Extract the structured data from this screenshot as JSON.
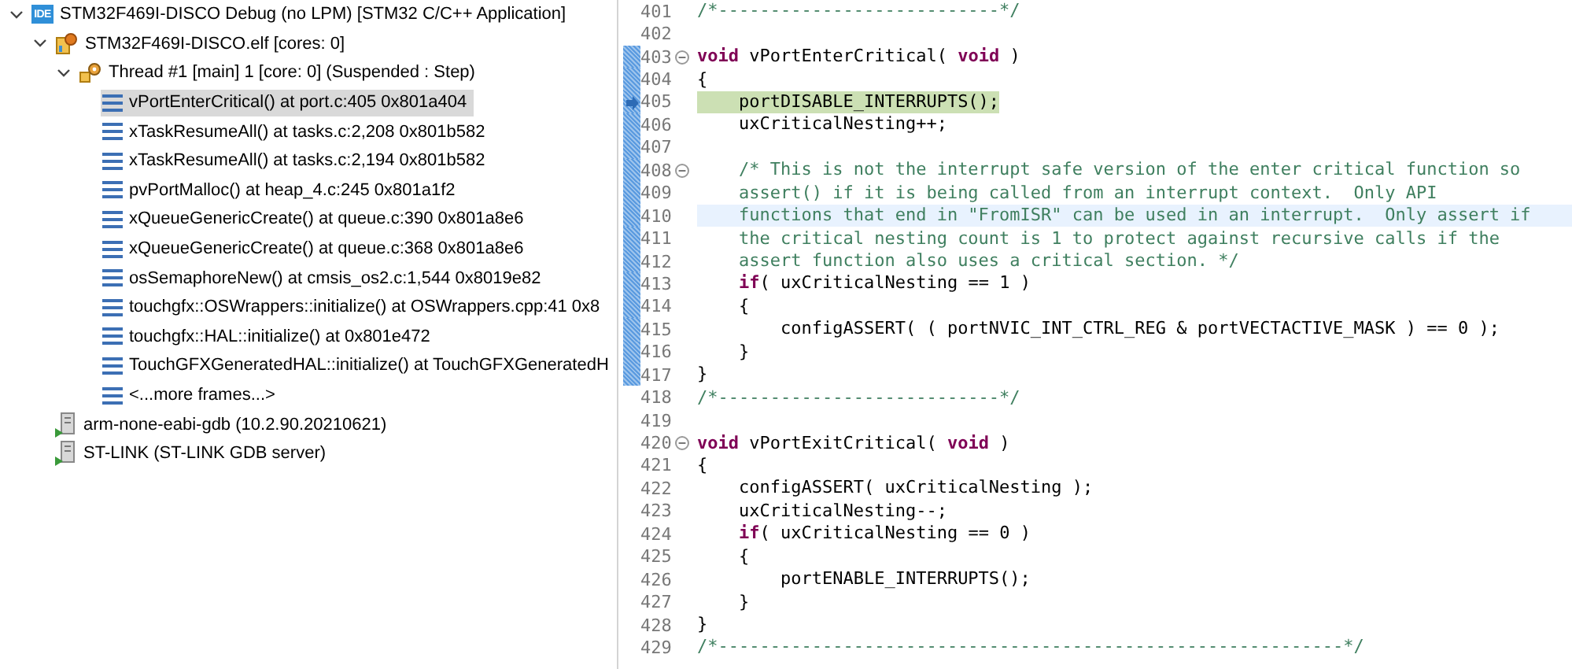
{
  "debug_tree": [
    {
      "kind": "launch",
      "badge": "IDE",
      "label": "STM32F469I-DISCO Debug (no LPM) [STM32 C/C++ Application]",
      "expanded": true,
      "children": [
        {
          "kind": "target",
          "label": "STM32F469I-DISCO.elf [cores: 0]",
          "expanded": true,
          "children": [
            {
              "kind": "thread",
              "label": "Thread #1 [main] 1 [core: 0] (Suspended : Step)",
              "expanded": true,
              "children": [
                {
                  "kind": "frame",
                  "label": "vPortEnterCritical() at port.c:405 0x801a404",
                  "selected": true
                },
                {
                  "kind": "frame",
                  "label": "xTaskResumeAll() at tasks.c:2,208 0x801b582",
                  "selected": false
                },
                {
                  "kind": "frame",
                  "label": "xTaskResumeAll() at tasks.c:2,194 0x801b582",
                  "selected": false
                },
                {
                  "kind": "frame",
                  "label": "pvPortMalloc() at heap_4.c:245 0x801a1f2",
                  "selected": false
                },
                {
                  "kind": "frame",
                  "label": "xQueueGenericCreate() at queue.c:390 0x801a8e6",
                  "selected": false
                },
                {
                  "kind": "frame",
                  "label": "xQueueGenericCreate() at queue.c:368 0x801a8e6",
                  "selected": false
                },
                {
                  "kind": "frame",
                  "label": "osSemaphoreNew() at cmsis_os2.c:1,544 0x8019e82",
                  "selected": false
                },
                {
                  "kind": "frame",
                  "label": "touchgfx::OSWrappers::initialize() at OSWrappers.cpp:41 0x8",
                  "selected": false
                },
                {
                  "kind": "frame",
                  "label": "touchgfx::HAL::initialize() at 0x801e472",
                  "selected": false
                },
                {
                  "kind": "frame",
                  "label": "TouchGFXGeneratedHAL::initialize() at TouchGFXGeneratedH",
                  "selected": false
                },
                {
                  "kind": "frame",
                  "label": "<...more frames...>",
                  "selected": false
                }
              ]
            }
          ]
        },
        {
          "kind": "process",
          "label": "arm-none-eabi-gdb (10.2.90.20210621)"
        },
        {
          "kind": "process",
          "label": "ST-LINK (ST-LINK GDB server)"
        }
      ]
    }
  ],
  "editor": {
    "lines": [
      {
        "number": "401",
        "foldable": false,
        "current": false,
        "highlighted": false,
        "in_range": false,
        "segments": [
          {
            "kind": "comment",
            "text": "/*---------------------------*/"
          }
        ]
      },
      {
        "number": "402",
        "foldable": false,
        "current": false,
        "highlighted": false,
        "in_range": false
      },
      {
        "number": "403",
        "foldable": true,
        "current": false,
        "highlighted": false,
        "in_range": true,
        "segments": [
          {
            "kind": "keyword",
            "text": "void"
          },
          {
            "kind": "plain",
            "text": " vPortEnterCritical( "
          },
          {
            "kind": "keyword",
            "text": "void"
          },
          {
            "kind": "plain",
            "text": " )"
          }
        ]
      },
      {
        "number": "404",
        "foldable": false,
        "current": false,
        "highlighted": false,
        "in_range": true,
        "segments": [
          {
            "kind": "plain",
            "text": "{"
          }
        ]
      },
      {
        "number": "405",
        "foldable": false,
        "current": true,
        "highlighted": false,
        "in_range": true,
        "segments": [
          {
            "kind": "plain",
            "text": "    portDISABLE_INTERRUPTS();"
          }
        ]
      },
      {
        "number": "406",
        "foldable": false,
        "current": false,
        "highlighted": false,
        "in_range": true,
        "segments": [
          {
            "kind": "plain",
            "text": "    uxCriticalNesting++;"
          }
        ]
      },
      {
        "number": "407",
        "foldable": false,
        "current": false,
        "highlighted": false,
        "in_range": true
      },
      {
        "number": "408",
        "foldable": true,
        "current": false,
        "highlighted": false,
        "in_range": true,
        "segments": [
          {
            "kind": "comment",
            "text": "    /* This is not the interrupt safe version of the enter critical function so"
          }
        ]
      },
      {
        "number": "409",
        "foldable": false,
        "current": false,
        "highlighted": false,
        "in_range": true,
        "segments": [
          {
            "kind": "comment",
            "text": "    assert() if it is being called from an interrupt context.  Only API"
          }
        ]
      },
      {
        "number": "410",
        "foldable": false,
        "current": false,
        "highlighted": true,
        "in_range": true,
        "segments": [
          {
            "kind": "comment",
            "text": "    functions that end in \"FromISR\" can be used in an interrupt.  Only assert if"
          }
        ]
      },
      {
        "number": "411",
        "foldable": false,
        "current": false,
        "highlighted": false,
        "in_range": true,
        "segments": [
          {
            "kind": "comment",
            "text": "    the critical nesting count is 1 to protect against recursive calls if the"
          }
        ]
      },
      {
        "number": "412",
        "foldable": false,
        "current": false,
        "highlighted": false,
        "in_range": true,
        "segments": [
          {
            "kind": "comment",
            "text": "    assert function also uses a critical section. */"
          }
        ]
      },
      {
        "number": "413",
        "foldable": false,
        "current": false,
        "highlighted": false,
        "in_range": true,
        "segments": [
          {
            "kind": "keyword",
            "text": "    if"
          },
          {
            "kind": "plain",
            "text": "( uxCriticalNesting == 1 )"
          }
        ]
      },
      {
        "number": "414",
        "foldable": false,
        "current": false,
        "highlighted": false,
        "in_range": true,
        "segments": [
          {
            "kind": "plain",
            "text": "    {"
          }
        ]
      },
      {
        "number": "415",
        "foldable": false,
        "current": false,
        "highlighted": false,
        "in_range": true,
        "segments": [
          {
            "kind": "plain",
            "text": "        configASSERT( ( portNVIC_INT_CTRL_REG & portVECTACTIVE_MASK ) == 0 );"
          }
        ]
      },
      {
        "number": "416",
        "foldable": false,
        "current": false,
        "highlighted": false,
        "in_range": true,
        "segments": [
          {
            "kind": "plain",
            "text": "    }"
          }
        ]
      },
      {
        "number": "417",
        "foldable": false,
        "current": false,
        "highlighted": false,
        "in_range": true,
        "segments": [
          {
            "kind": "plain",
            "text": "}"
          }
        ]
      },
      {
        "number": "418",
        "foldable": false,
        "current": false,
        "highlighted": false,
        "in_range": false,
        "segments": [
          {
            "kind": "comment",
            "text": "/*---------------------------*/"
          }
        ]
      },
      {
        "number": "419",
        "foldable": false,
        "current": false,
        "highlighted": false,
        "in_range": false
      },
      {
        "number": "420",
        "foldable": true,
        "current": false,
        "highlighted": false,
        "in_range": false,
        "segments": [
          {
            "kind": "keyword",
            "text": "void"
          },
          {
            "kind": "plain",
            "text": " vPortExitCritical( "
          },
          {
            "kind": "keyword",
            "text": "void"
          },
          {
            "kind": "plain",
            "text": " )"
          }
        ]
      },
      {
        "number": "421",
        "foldable": false,
        "current": false,
        "highlighted": false,
        "in_range": false,
        "segments": [
          {
            "kind": "plain",
            "text": "{"
          }
        ]
      },
      {
        "number": "422",
        "foldable": false,
        "current": false,
        "highlighted": false,
        "in_range": false,
        "segments": [
          {
            "kind": "plain",
            "text": "    configASSERT( uxCriticalNesting );"
          }
        ]
      },
      {
        "number": "423",
        "foldable": false,
        "current": false,
        "highlighted": false,
        "in_range": false,
        "segments": [
          {
            "kind": "plain",
            "text": "    uxCriticalNesting--;"
          }
        ]
      },
      {
        "number": "424",
        "foldable": false,
        "current": false,
        "highlighted": false,
        "in_range": false,
        "segments": [
          {
            "kind": "keyword",
            "text": "    if"
          },
          {
            "kind": "plain",
            "text": "( uxCriticalNesting == 0 )"
          }
        ]
      },
      {
        "number": "425",
        "foldable": false,
        "current": false,
        "highlighted": false,
        "in_range": false,
        "segments": [
          {
            "kind": "plain",
            "text": "    {"
          }
        ]
      },
      {
        "number": "426",
        "foldable": false,
        "current": false,
        "highlighted": false,
        "in_range": false,
        "segments": [
          {
            "kind": "plain",
            "text": "        portENABLE_INTERRUPTS();"
          }
        ]
      },
      {
        "number": "427",
        "foldable": false,
        "current": false,
        "highlighted": false,
        "in_range": false,
        "segments": [
          {
            "kind": "plain",
            "text": "    }"
          }
        ]
      },
      {
        "number": "428",
        "foldable": false,
        "current": false,
        "highlighted": false,
        "in_range": false,
        "segments": [
          {
            "kind": "plain",
            "text": "}"
          }
        ]
      },
      {
        "number": "429",
        "foldable": false,
        "current": false,
        "highlighted": false,
        "in_range": false,
        "segments": [
          {
            "kind": "comment",
            "text": "/*------------------------------------------------------------*/"
          }
        ]
      }
    ]
  }
}
